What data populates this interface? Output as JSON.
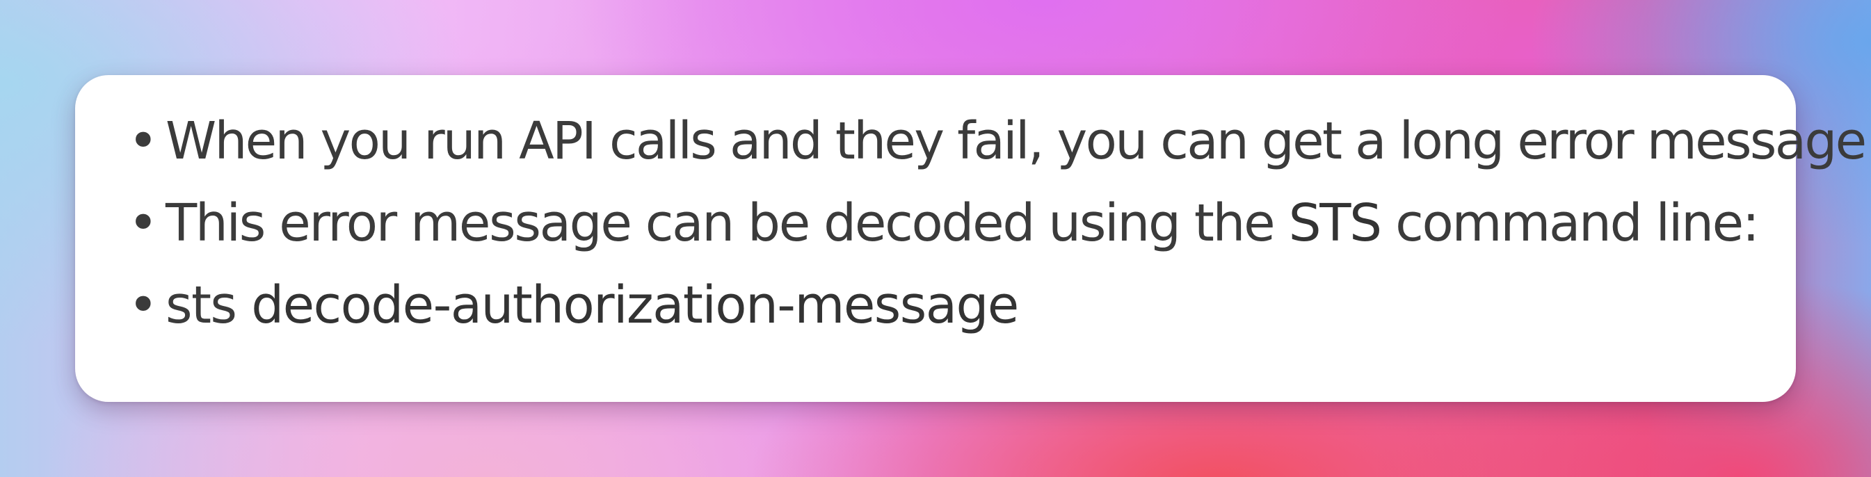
{
  "slide": {
    "bullets": [
      {
        "text": "When you run API calls and they fail, you can get a long error message"
      },
      {
        "before": "This error message can be decoded using the ",
        "emphasis": "STS",
        "after": " command line:"
      },
      {
        "before": "sts ",
        "emphasis": "decode-authorization-message"
      }
    ]
  },
  "colors": {
    "text": "#3b3b3b",
    "card_background": "#ffffff"
  },
  "icons": {
    "bullet": "bullet-dot-icon"
  }
}
